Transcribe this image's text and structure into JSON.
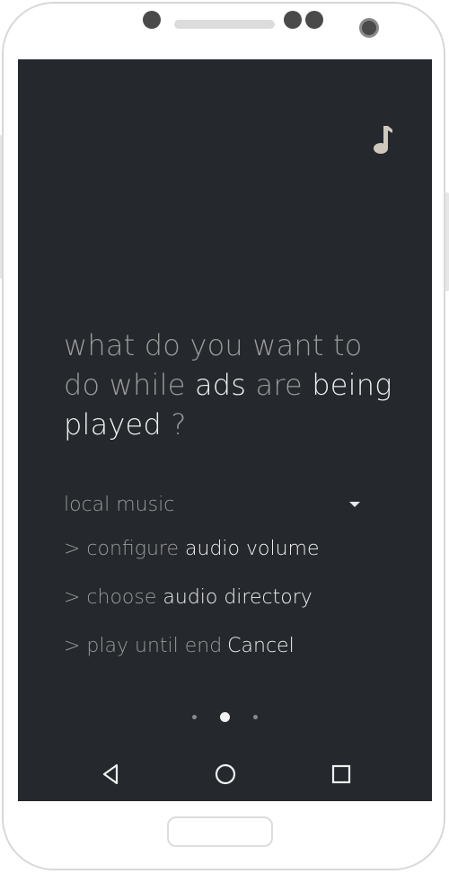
{
  "headline": {
    "part1": "what do you want to do while ",
    "highlight1": "ads",
    "part2": " are ",
    "highlight2": "being played",
    "part3": " ?"
  },
  "dropdown": {
    "selected": "local music"
  },
  "options": [
    {
      "prefix": "> configure ",
      "highlight": "audio volume"
    },
    {
      "prefix": "> choose ",
      "highlight": "audio directory"
    },
    {
      "prefix": "> play until end",
      "action": "Cancel"
    }
  ],
  "pager": {
    "count": 3,
    "active_index": 1
  },
  "icons": {
    "top_right": "music-note-icon",
    "nav": [
      "back-icon",
      "home-icon",
      "recents-icon"
    ]
  },
  "colors": {
    "screen_bg": "#25282c",
    "muted_text": "#9a9a9a",
    "highlight_text": "#eeeeee",
    "music_icon": "#cfc8bc"
  }
}
